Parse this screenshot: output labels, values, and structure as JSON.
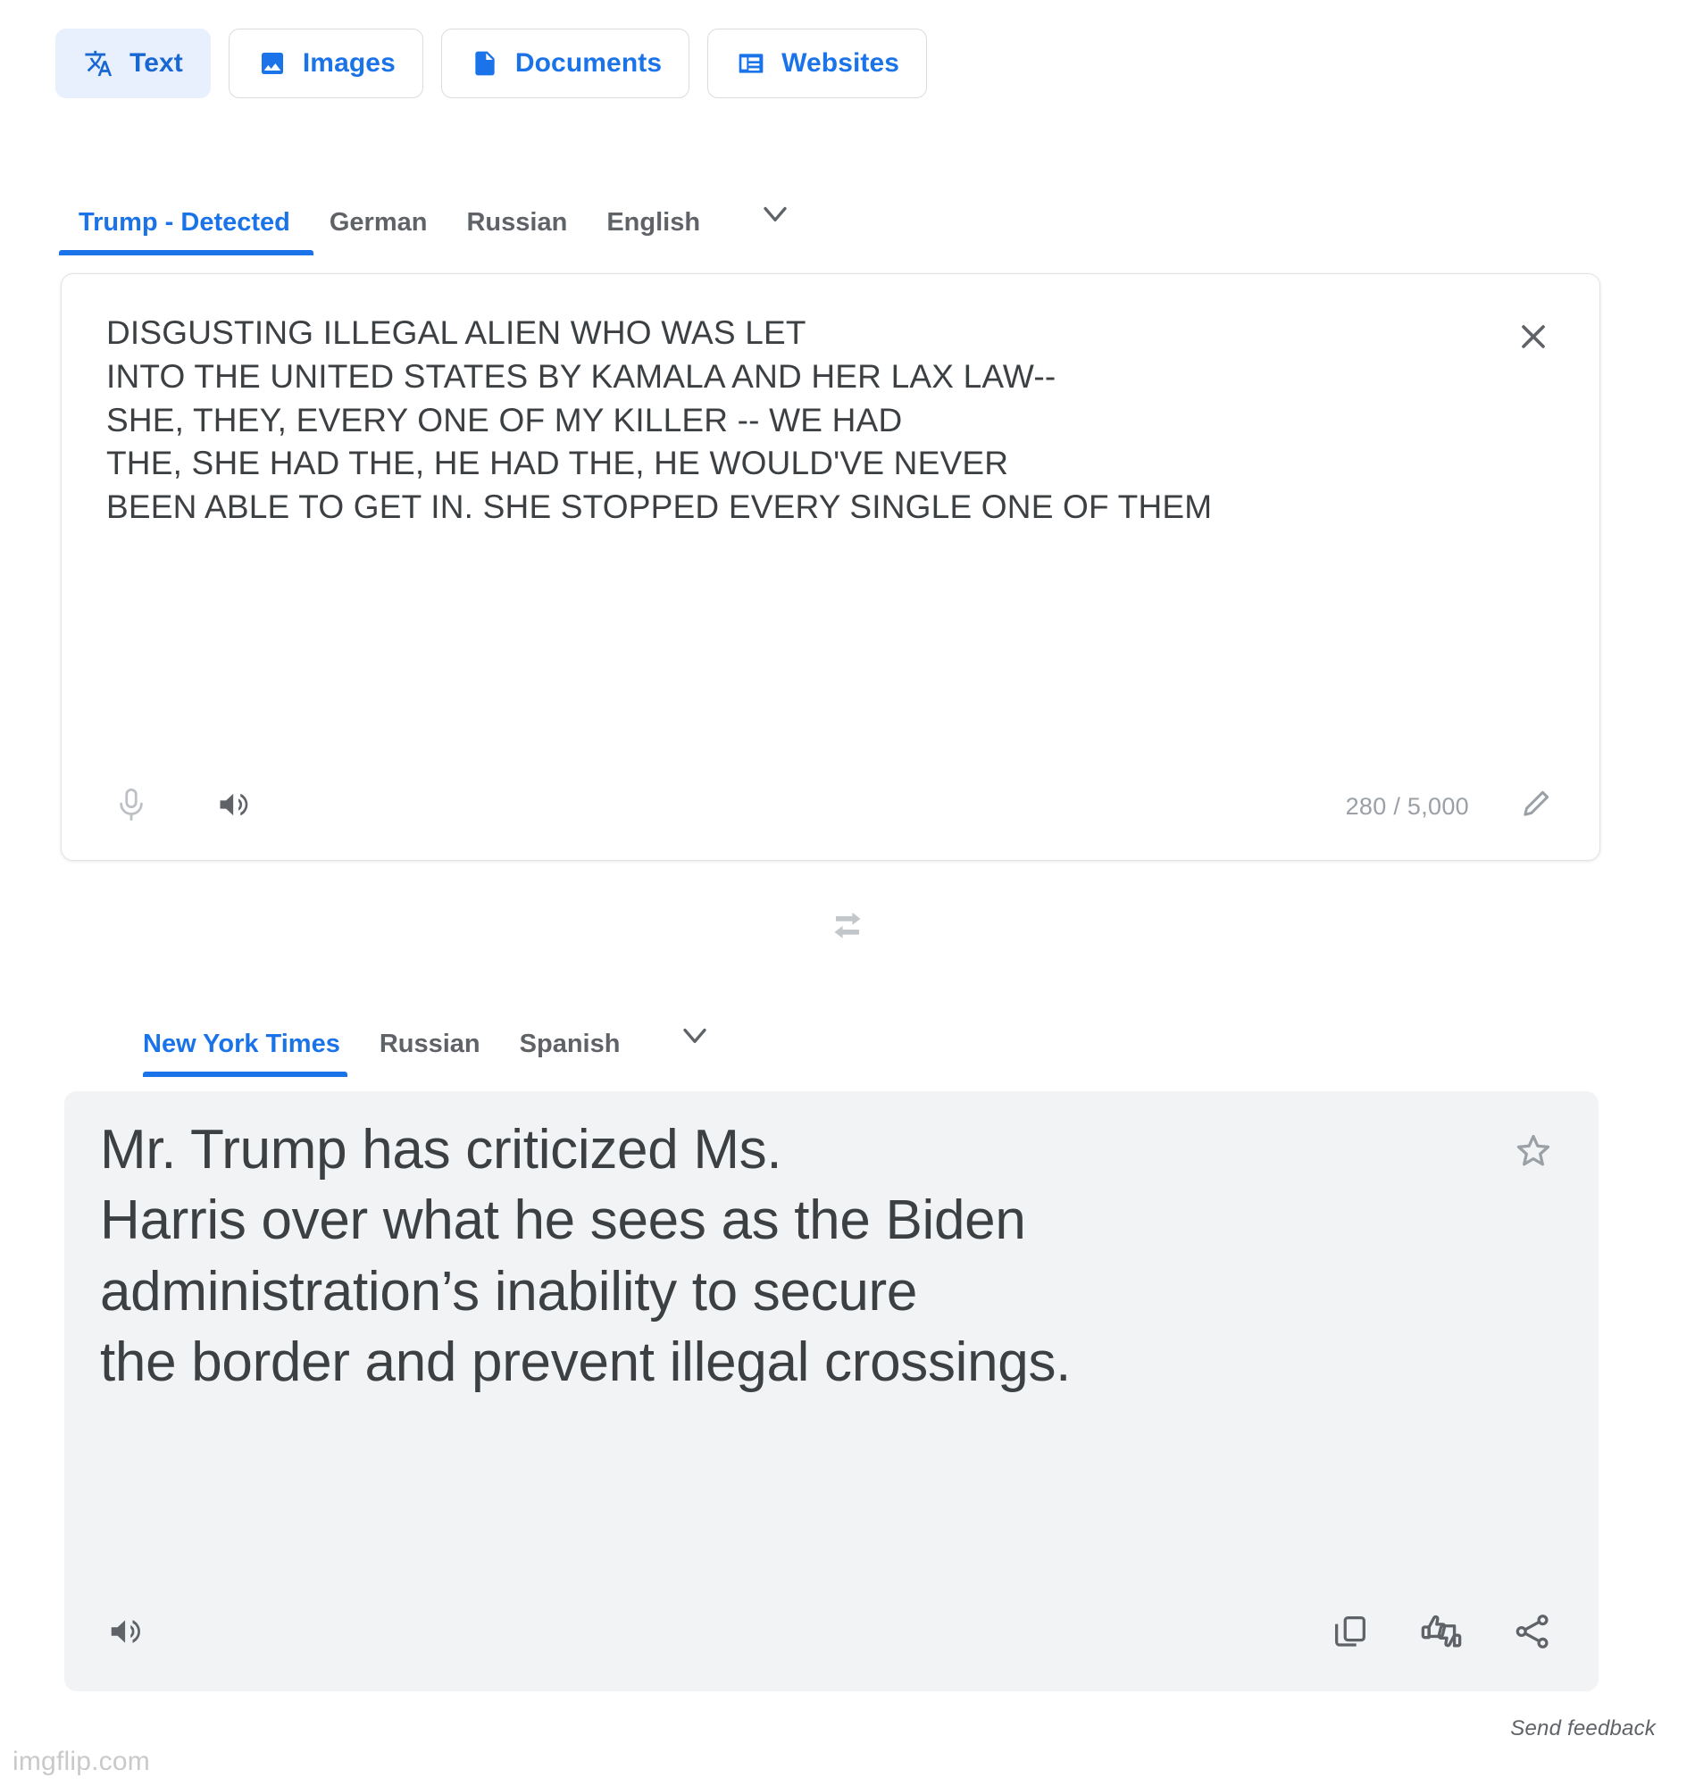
{
  "mode_tabs": [
    {
      "label": "Text",
      "icon": "translate-icon",
      "active": true
    },
    {
      "label": "Images",
      "icon": "image-icon",
      "active": false
    },
    {
      "label": "Documents",
      "icon": "document-icon",
      "active": false
    },
    {
      "label": "Websites",
      "icon": "website-icon",
      "active": false
    }
  ],
  "source": {
    "lang_tabs": [
      {
        "label": "Trump - Detected",
        "active": true
      },
      {
        "label": "German",
        "active": false
      },
      {
        "label": "Russian",
        "active": false
      },
      {
        "label": "English",
        "active": false
      }
    ],
    "more_languages_icon": "chevron-down-icon",
    "text": "DISGUSTING ILLEGAL ALIEN WHO WAS LET\nINTO THE UNITED STATES BY KAMALA AND HER LAX LAW--\nSHE, THEY, EVERY ONE OF MY KILLER -- WE HAD\nTHE, SHE HAD THE, HE HAD THE, HE WOULD'VE NEVER\nBEEN ABLE TO GET IN. SHE STOPPED EVERY SINGLE ONE OF THEM",
    "char_count": "280 / 5,000",
    "clear_icon": "close-icon",
    "mic_icon": "microphone-icon",
    "listen_icon": "speaker-icon",
    "edit_icon": "pencil-icon"
  },
  "swap": {
    "icon": "swap-arrows-icon"
  },
  "target": {
    "lang_tabs": [
      {
        "label": "New York Times",
        "active": true
      },
      {
        "label": "Russian",
        "active": false
      },
      {
        "label": "Spanish",
        "active": false
      }
    ],
    "more_languages_icon": "chevron-down-icon",
    "text": "Mr. Trump has criticized Ms.\nHarris over what he sees as the Biden\nadministration’s inability to secure\nthe border and prevent illegal crossings.",
    "star_icon": "star-outline-icon",
    "listen_icon": "speaker-icon",
    "copy_icon": "copy-icon",
    "rate_icon": "thumbs-up-down-icon",
    "share_icon": "share-icon"
  },
  "footer": {
    "send_feedback": "Send feedback",
    "watermark": "imgflip.com"
  },
  "colors": {
    "accent": "#1a73e8",
    "accent_soft": "#e8f0fe",
    "text_primary": "#3c4043",
    "text_muted": "#5f6368",
    "panel_bg": "#f1f3f4"
  }
}
